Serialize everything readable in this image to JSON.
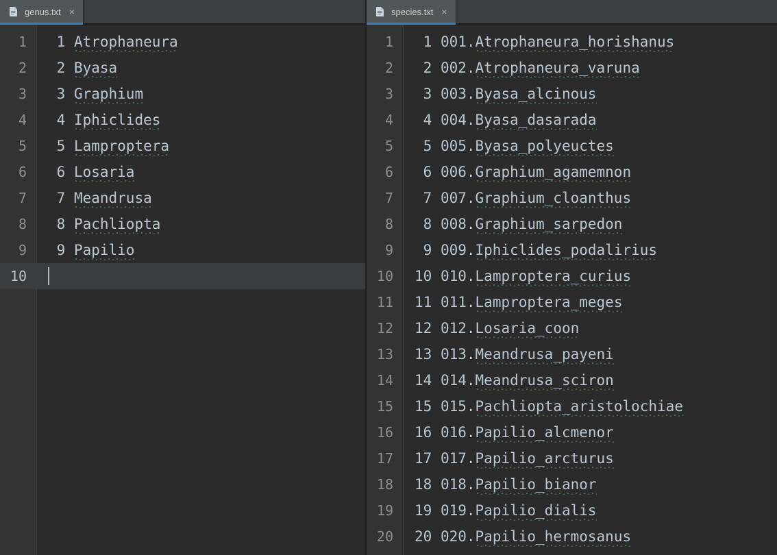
{
  "left": {
    "tab": {
      "filename": "genus.txt"
    },
    "active_line": 10,
    "lines": [
      {
        "n": 1,
        "idx": "1",
        "text": "Atrophaneura"
      },
      {
        "n": 2,
        "idx": "2",
        "text": "Byasa"
      },
      {
        "n": 3,
        "idx": "3",
        "text": "Graphium"
      },
      {
        "n": 4,
        "idx": "4",
        "text": "Iphiclides"
      },
      {
        "n": 5,
        "idx": "5",
        "text": "Lamproptera"
      },
      {
        "n": 6,
        "idx": "6",
        "text": "Losaria"
      },
      {
        "n": 7,
        "idx": "7",
        "text": "Meandrusa"
      },
      {
        "n": 8,
        "idx": "8",
        "text": "Pachliopta"
      },
      {
        "n": 9,
        "idx": "9",
        "text": "Papilio"
      },
      {
        "n": 10,
        "idx": "",
        "text": ""
      }
    ]
  },
  "right": {
    "tab": {
      "filename": "species.txt"
    },
    "lines": [
      {
        "n": 1,
        "idx": "1",
        "text": "001.Atrophaneura_horishanus"
      },
      {
        "n": 2,
        "idx": "2",
        "text": "002.Atrophaneura_varuna"
      },
      {
        "n": 3,
        "idx": "3",
        "text": "003.Byasa_alcinous"
      },
      {
        "n": 4,
        "idx": "4",
        "text": "004.Byasa_dasarada"
      },
      {
        "n": 5,
        "idx": "5",
        "text": "005.Byasa_polyeuctes"
      },
      {
        "n": 6,
        "idx": "6",
        "text": "006.Graphium_agamemnon"
      },
      {
        "n": 7,
        "idx": "7",
        "text": "007.Graphium_cloanthus"
      },
      {
        "n": 8,
        "idx": "8",
        "text": "008.Graphium_sarpedon"
      },
      {
        "n": 9,
        "idx": "9",
        "text": "009.Iphiclides_podalirius"
      },
      {
        "n": 10,
        "idx": "10",
        "text": "010.Lamproptera_curius"
      },
      {
        "n": 11,
        "idx": "11",
        "text": "011.Lamproptera_meges"
      },
      {
        "n": 12,
        "idx": "12",
        "text": "012.Losaria_coon"
      },
      {
        "n": 13,
        "idx": "13",
        "text": "013.Meandrusa_payeni"
      },
      {
        "n": 14,
        "idx": "14",
        "text": "014.Meandrusa_sciron"
      },
      {
        "n": 15,
        "idx": "15",
        "text": "015.Pachliopta_aristolochiae"
      },
      {
        "n": 16,
        "idx": "16",
        "text": "016.Papilio_alcmenor"
      },
      {
        "n": 17,
        "idx": "17",
        "text": "017.Papilio_arcturus"
      },
      {
        "n": 18,
        "idx": "18",
        "text": "018.Papilio_bianor"
      },
      {
        "n": 19,
        "idx": "19",
        "text": "019.Papilio_dialis"
      },
      {
        "n": 20,
        "idx": "20",
        "text": "020.Papilio_hermosanus"
      }
    ]
  }
}
